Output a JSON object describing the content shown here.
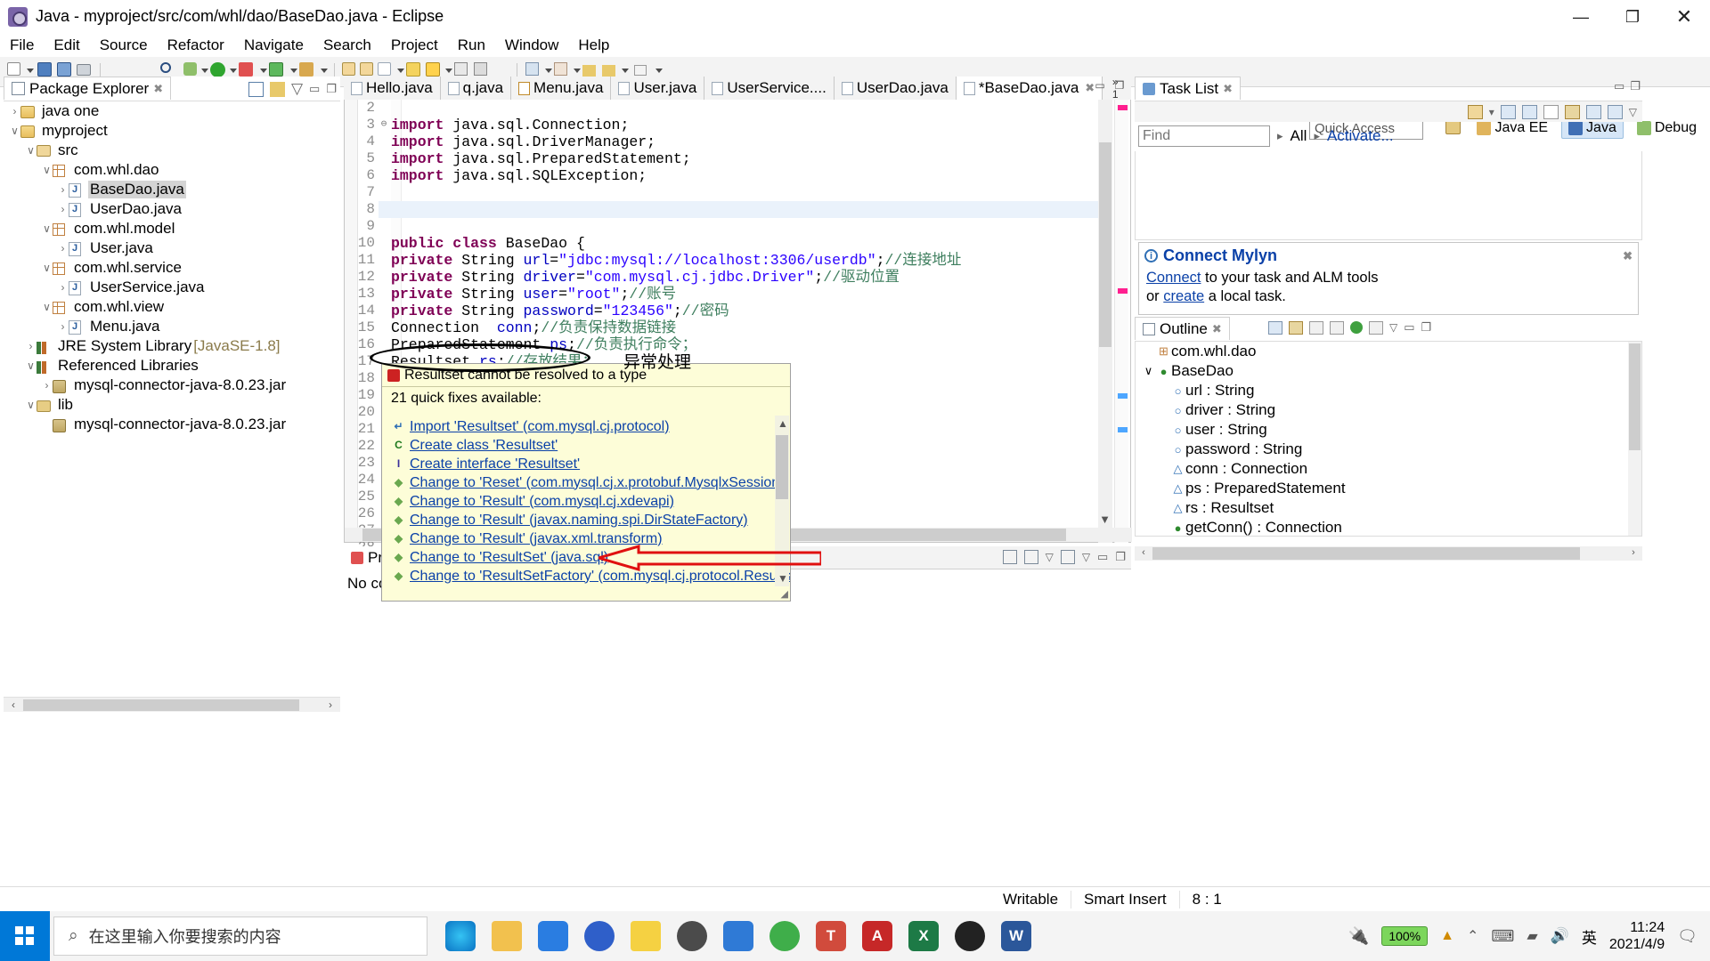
{
  "window": {
    "title": "Java - myproject/src/com/whl/dao/BaseDao.java - Eclipse",
    "minimize": "—",
    "maximize": "❐",
    "close": "✕"
  },
  "menubar": [
    "File",
    "Edit",
    "Source",
    "Refactor",
    "Navigate",
    "Search",
    "Project",
    "Run",
    "Window",
    "Help"
  ],
  "toolbar": {
    "quick_access_placeholder": "Quick Access",
    "perspectives": [
      {
        "label": "Java EE",
        "active": false
      },
      {
        "label": "Java",
        "active": true
      },
      {
        "label": "Debug",
        "active": false
      }
    ]
  },
  "package_explorer": {
    "tab_label": "Package Explorer",
    "close_glyph": "✖",
    "tree": [
      {
        "indent": 0,
        "twist": "›",
        "icon": "project",
        "label": "java one",
        "selected": false
      },
      {
        "indent": 0,
        "twist": "∨",
        "icon": "project",
        "label": "myproject",
        "selected": false
      },
      {
        "indent": 1,
        "twist": "∨",
        "icon": "pkgroot",
        "label": "src",
        "selected": false
      },
      {
        "indent": 2,
        "twist": "∨",
        "icon": "pkg",
        "label": "com.whl.dao",
        "selected": false
      },
      {
        "indent": 3,
        "twist": "›",
        "icon": "java",
        "label": "BaseDao.java",
        "selected": true
      },
      {
        "indent": 3,
        "twist": "›",
        "icon": "java",
        "label": "UserDao.java",
        "selected": false
      },
      {
        "indent": 2,
        "twist": "∨",
        "icon": "pkg",
        "label": "com.whl.model",
        "selected": false
      },
      {
        "indent": 3,
        "twist": "›",
        "icon": "java",
        "label": "User.java",
        "selected": false
      },
      {
        "indent": 2,
        "twist": "∨",
        "icon": "pkg",
        "label": "com.whl.service",
        "selected": false
      },
      {
        "indent": 3,
        "twist": "›",
        "icon": "java",
        "label": "UserService.java",
        "selected": false
      },
      {
        "indent": 2,
        "twist": "∨",
        "icon": "pkg",
        "label": "com.whl.view",
        "selected": false
      },
      {
        "indent": 3,
        "twist": "›",
        "icon": "java",
        "label": "Menu.java",
        "selected": false
      },
      {
        "indent": 1,
        "twist": "›",
        "icon": "lib",
        "label": "JRE System Library",
        "sub": "[JavaSE-1.8]",
        "selected": false
      },
      {
        "indent": 1,
        "twist": "∨",
        "icon": "lib",
        "label": "Referenced Libraries",
        "selected": false
      },
      {
        "indent": 2,
        "twist": "›",
        "icon": "jar",
        "label": "mysql-connector-java-8.0.23.jar",
        "selected": false
      },
      {
        "indent": 1,
        "twist": "∨",
        "icon": "folder",
        "label": "lib",
        "selected": false
      },
      {
        "indent": 2,
        "twist": "",
        "icon": "jar",
        "label": "mysql-connector-java-8.0.23.jar",
        "selected": false
      }
    ]
  },
  "editor": {
    "tabs": [
      {
        "label": "Hello.java",
        "active": false,
        "dirty": false,
        "warn": false
      },
      {
        "label": "q.java",
        "active": false,
        "dirty": false,
        "warn": false
      },
      {
        "label": "Menu.java",
        "active": false,
        "dirty": false,
        "warn": true
      },
      {
        "label": "User.java",
        "active": false,
        "dirty": false,
        "warn": false
      },
      {
        "label": "UserService....",
        "active": false,
        "dirty": false,
        "warn": false
      },
      {
        "label": "UserDao.java",
        "active": false,
        "dirty": false,
        "warn": false
      },
      {
        "label": "*BaseDao.java",
        "active": true,
        "dirty": true,
        "warn": false
      }
    ],
    "overflow_label": "»",
    "overflow_count": "1",
    "lines": [
      {
        "no": "2",
        "fold": "",
        "cur": false,
        "segments": [
          {
            "t": "",
            "c": "plain"
          }
        ]
      },
      {
        "no": "3",
        "fold": "⊖",
        "cur": false,
        "segments": [
          {
            "t": "import",
            "c": "kw"
          },
          {
            "t": " java.sql.Connection;",
            "c": "plain"
          }
        ]
      },
      {
        "no": "4",
        "fold": "",
        "cur": false,
        "segments": [
          {
            "t": "import",
            "c": "kw"
          },
          {
            "t": " java.sql.DriverManager;",
            "c": "plain"
          }
        ]
      },
      {
        "no": "5",
        "fold": "",
        "cur": false,
        "segments": [
          {
            "t": "import",
            "c": "kw"
          },
          {
            "t": " java.sql.PreparedStatement;",
            "c": "plain"
          }
        ]
      },
      {
        "no": "6",
        "fold": "",
        "cur": false,
        "segments": [
          {
            "t": "import",
            "c": "kw"
          },
          {
            "t": " java.sql.SQLException;",
            "c": "plain"
          }
        ]
      },
      {
        "no": "7",
        "fold": "",
        "cur": false,
        "segments": [
          {
            "t": "",
            "c": "plain"
          }
        ]
      },
      {
        "no": "8",
        "fold": "",
        "cur": true,
        "segments": [
          {
            "t": "",
            "c": "plain"
          }
        ]
      },
      {
        "no": "9",
        "fold": "",
        "cur": false,
        "segments": [
          {
            "t": "",
            "c": "plain"
          }
        ]
      },
      {
        "no": "10",
        "fold": "",
        "cur": false,
        "segments": [
          {
            "t": "public class",
            "c": "kw"
          },
          {
            "t": " BaseDao {",
            "c": "plain"
          }
        ]
      },
      {
        "no": "11",
        "fold": "",
        "cur": false,
        "segments": [
          {
            "t": "private",
            "c": "kw"
          },
          {
            "t": " String ",
            "c": "plain"
          },
          {
            "t": "url",
            "c": "fld"
          },
          {
            "t": "=",
            "c": "plain"
          },
          {
            "t": "\"jdbc:mysql://localhost:3306/userdb\"",
            "c": "str"
          },
          {
            "t": ";",
            "c": "plain"
          },
          {
            "t": "//连接地址",
            "c": "cmt"
          }
        ]
      },
      {
        "no": "12",
        "fold": "",
        "cur": false,
        "segments": [
          {
            "t": "private",
            "c": "kw"
          },
          {
            "t": " String ",
            "c": "plain"
          },
          {
            "t": "driver",
            "c": "fld"
          },
          {
            "t": "=",
            "c": "plain"
          },
          {
            "t": "\"com.mysql.cj.jdbc.Driver\"",
            "c": "str"
          },
          {
            "t": ";",
            "c": "plain"
          },
          {
            "t": "//驱动位置",
            "c": "cmt"
          }
        ]
      },
      {
        "no": "13",
        "fold": "",
        "cur": false,
        "segments": [
          {
            "t": "private",
            "c": "kw"
          },
          {
            "t": " String ",
            "c": "plain"
          },
          {
            "t": "user",
            "c": "fld"
          },
          {
            "t": "=",
            "c": "plain"
          },
          {
            "t": "\"root\"",
            "c": "str"
          },
          {
            "t": ";",
            "c": "plain"
          },
          {
            "t": "//账号",
            "c": "cmt"
          }
        ]
      },
      {
        "no": "14",
        "fold": "",
        "cur": false,
        "segments": [
          {
            "t": "private",
            "c": "kw"
          },
          {
            "t": " String ",
            "c": "plain"
          },
          {
            "t": "password",
            "c": "fld"
          },
          {
            "t": "=",
            "c": "plain"
          },
          {
            "t": "\"123456\"",
            "c": "str"
          },
          {
            "t": ";",
            "c": "plain"
          },
          {
            "t": "//密码",
            "c": "cmt"
          }
        ]
      },
      {
        "no": "15",
        "fold": "",
        "cur": false,
        "segments": [
          {
            "t": "Connection  ",
            "c": "plain"
          },
          {
            "t": "conn",
            "c": "fld"
          },
          {
            "t": ";",
            "c": "plain"
          },
          {
            "t": "//负责保持数据链接",
            "c": "cmt"
          }
        ]
      },
      {
        "no": "16",
        "fold": "",
        "cur": false,
        "segments": [
          {
            "t": "PreparedStatement ",
            "c": "plain"
          },
          {
            "t": "ps",
            "c": "fld"
          },
          {
            "t": ";",
            "c": "plain"
          },
          {
            "t": "//负责执行命令；",
            "c": "cmt"
          }
        ]
      },
      {
        "no": "17",
        "fold": "",
        "cur": false,
        "segments": [
          {
            "t": "Resultset",
            "c": "und"
          },
          {
            "t": " ",
            "c": "plain"
          },
          {
            "t": "rs",
            "c": "fld"
          },
          {
            "t": ";",
            "c": "plain"
          },
          {
            "t": "//存放结果；",
            "c": "cmt"
          }
        ]
      },
      {
        "no": "18",
        "fold": "⊖",
        "cur": false,
        "segments": [
          {
            "t": "",
            "c": "plain"
          }
        ]
      },
      {
        "no": "19",
        "fold": "",
        "cur": false,
        "segments": [
          {
            "t": "",
            "c": "plain"
          }
        ]
      },
      {
        "no": "20",
        "fold": "",
        "cur": false,
        "segments": [
          {
            "t": "",
            "c": "plain"
          }
        ]
      },
      {
        "no": "21",
        "fold": "",
        "cur": false,
        "segments": [
          {
            "t": "",
            "c": "plain"
          }
        ]
      },
      {
        "no": "22",
        "fold": "⊖",
        "cur": false,
        "segments": [
          {
            "t": "",
            "c": "plain"
          }
        ]
      },
      {
        "no": "23",
        "fold": "",
        "cur": false,
        "segments": [
          {
            "t": "",
            "c": "plain"
          }
        ]
      },
      {
        "no": "24",
        "fold": "",
        "cur": false,
        "segments": [
          {
            "t": "",
            "c": "plain"
          }
        ]
      },
      {
        "no": "25",
        "fold": "",
        "cur": false,
        "segments": [
          {
            "t": "",
            "c": "plain"
          }
        ]
      },
      {
        "no": "26",
        "fold": "",
        "cur": false,
        "segments": [
          {
            "t": "",
            "c": "plain"
          }
        ]
      },
      {
        "no": "27",
        "fold": "",
        "cur": false,
        "segments": [
          {
            "t": "",
            "c": "plain"
          }
        ]
      },
      {
        "no": "28",
        "fold": "",
        "cur": false,
        "segments": [
          {
            "t": "",
            "c": "plain"
          }
        ]
      }
    ]
  },
  "quickfix": {
    "error_message": "Resultset cannot be resolved to a type",
    "count_label": "21 quick fixes available:",
    "items": [
      {
        "icon": "import",
        "label": "Import 'Resultset' (com.mysql.cj.protocol)"
      },
      {
        "icon": "class",
        "label": "Create class 'Resultset'"
      },
      {
        "icon": "interface",
        "label": "Create interface 'Resultset'"
      },
      {
        "icon": "change",
        "label": "Change to 'Reset' (com.mysql.cj.x.protobuf.MysqlxSession)"
      },
      {
        "icon": "change",
        "label": "Change to 'Result' (com.mysql.cj.xdevapi)"
      },
      {
        "icon": "change",
        "label": "Change to 'Result' (javax.naming.spi.DirStateFactory)"
      },
      {
        "icon": "change",
        "label": "Change to 'Result' (javax.xml.transform)"
      },
      {
        "icon": "change",
        "label": "Change to 'ResultSet' (java.sql)"
      },
      {
        "icon": "change",
        "label": "Change to 'ResultSetFactory' (com.mysql.cj.protocol.Resultset)"
      }
    ]
  },
  "annotations": {
    "chinese_note": "异常处理"
  },
  "problems": {
    "tab_label": "Pro",
    "body_text": "No co"
  },
  "task_list": {
    "tab_label": "Task List",
    "close_glyph": "✖",
    "find_placeholder": "Find",
    "all_label": "All",
    "activate_label": "Activate...",
    "mylyn_title": "Connect Mylyn",
    "mylyn_line1_link": "Connect",
    "mylyn_line1_rest": " to your task and ALM tools",
    "mylyn_line2_pre": "or ",
    "mylyn_line2_link": "create",
    "mylyn_line2_rest": " a local task."
  },
  "outline": {
    "tab_label": "Outline",
    "close_glyph": "✖",
    "rows": [
      {
        "indent": 0,
        "twist": "",
        "icon": "pkg",
        "label": "com.whl.dao"
      },
      {
        "indent": 0,
        "twist": "∨",
        "icon": "class",
        "label": "BaseDao"
      },
      {
        "indent": 1,
        "twist": "",
        "icon": "field",
        "label": "url : String"
      },
      {
        "indent": 1,
        "twist": "",
        "icon": "field",
        "label": "driver : String"
      },
      {
        "indent": 1,
        "twist": "",
        "icon": "field",
        "label": "user : String"
      },
      {
        "indent": 1,
        "twist": "",
        "icon": "field",
        "label": "password : String"
      },
      {
        "indent": 1,
        "twist": "",
        "icon": "field-warn",
        "label": "conn : Connection"
      },
      {
        "indent": 1,
        "twist": "",
        "icon": "field-warn",
        "label": "ps : PreparedStatement"
      },
      {
        "indent": 1,
        "twist": "",
        "icon": "field-warn",
        "label": "rs : Resultset"
      },
      {
        "indent": 1,
        "twist": "",
        "icon": "method",
        "label": "getConn() : Connection"
      }
    ]
  },
  "statusbar": {
    "writable": "Writable",
    "insert_mode": "Smart Insert",
    "position": "8 : 1"
  },
  "taskbar": {
    "search_placeholder": "在这里输入你要搜索的内容",
    "battery": "100%",
    "ime": "英",
    "clock_time": "11:24",
    "clock_date": "2021/4/9"
  }
}
